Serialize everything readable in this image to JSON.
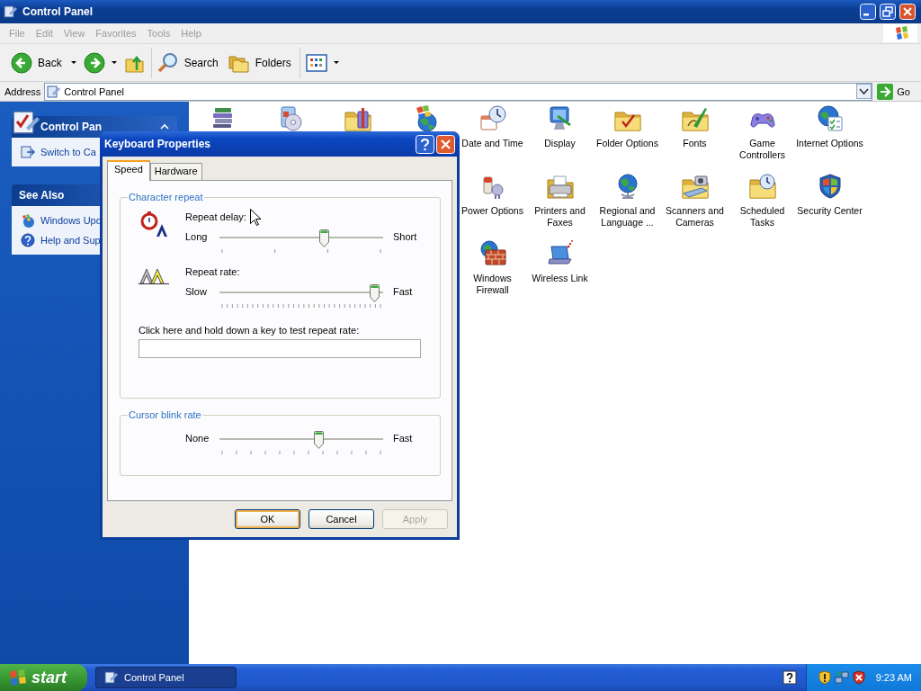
{
  "window": {
    "title": "Control Panel"
  },
  "menu": [
    "File",
    "Edit",
    "View",
    "Favorites",
    "Tools",
    "Help"
  ],
  "toolbar": [
    {
      "kind": "back",
      "label": "Back"
    },
    {
      "kind": "forward"
    },
    {
      "kind": "up"
    },
    {
      "kind": "search",
      "label": "Search"
    },
    {
      "kind": "folders",
      "label": "Folders"
    },
    {
      "kind": "views"
    }
  ],
  "address": {
    "label": "Address",
    "value": "Control Panel",
    "go": "Go"
  },
  "sidebar": {
    "panels": [
      {
        "title": "Control Pan",
        "items": [
          {
            "kind": "switch",
            "label": "Switch to Ca"
          }
        ]
      },
      {
        "title": "See Also",
        "items": [
          {
            "kind": "update",
            "label": "Windows Upd"
          },
          {
            "kind": "help",
            "label": "Help and Sup"
          }
        ]
      }
    ]
  },
  "icons": {
    "rows": [
      [
        {
          "kind": "books"
        },
        {
          "kind": "disc-box"
        },
        {
          "kind": "toolbox-folder"
        },
        {
          "kind": "globe-flag"
        },
        {
          "kind": "clock-calendar",
          "label": "Date and Time"
        },
        {
          "kind": "monitor",
          "label": "Display"
        },
        {
          "kind": "checkmark-folder",
          "label": "Folder Options"
        },
        {
          "kind": "pen-folder",
          "label": "Fonts"
        },
        {
          "kind": "gamepad",
          "label": "Game Controllers"
        },
        {
          "kind": "globe-checklist",
          "label": "Internet Options"
        }
      ],
      [
        "",
        "",
        "",
        "",
        {
          "kind": "battery-plug",
          "label": "Power Options"
        },
        {
          "kind": "printer",
          "label": "Printers and Faxes"
        },
        {
          "kind": "globe",
          "label": "Regional and Language ..."
        },
        {
          "kind": "scanner-camera",
          "label": "Scanners and Cameras"
        },
        {
          "kind": "clock-folder",
          "label": "Scheduled Tasks"
        },
        {
          "kind": "shield",
          "label": "Security Center"
        }
      ],
      [
        "",
        "",
        "",
        "",
        {
          "kind": "globe-brick-wall",
          "label": "Windows Firewall"
        },
        {
          "kind": "laptop",
          "label": "Wireless Link"
        }
      ]
    ]
  },
  "dialog": {
    "title": "Keyboard Properties",
    "tabs": [
      {
        "label": "Speed",
        "selected": true
      },
      {
        "label": "Hardware",
        "selected": false
      }
    ],
    "groups": [
      {
        "title": "Character repeat",
        "sliders": [
          {
            "kind": "delay",
            "label": "Repeat delay:",
            "min": "Long",
            "max": "Short",
            "level": 0.67
          },
          {
            "kind": "rate",
            "label": "Repeat rate:",
            "min": "Slow",
            "max": "Fast",
            "level": 1
          }
        ],
        "test": {
          "label": "Click here and hold down a key to test repeat rate:"
        }
      },
      {
        "title": "Cursor blink rate",
        "sliders": [
          {
            "kind": "blink",
            "min": "None",
            "max": "Fast",
            "level": 0.64
          }
        ]
      }
    ],
    "buttons": [
      {
        "label": "OK",
        "default": true,
        "disabled": false
      },
      {
        "label": "Cancel",
        "default": false,
        "disabled": false
      },
      {
        "label": "Apply",
        "default": false,
        "disabled": true
      }
    ]
  },
  "taskbar": {
    "start": "start",
    "tasks": [
      {
        "label": "Control Panel"
      }
    ],
    "clock": "9:23 AM"
  }
}
